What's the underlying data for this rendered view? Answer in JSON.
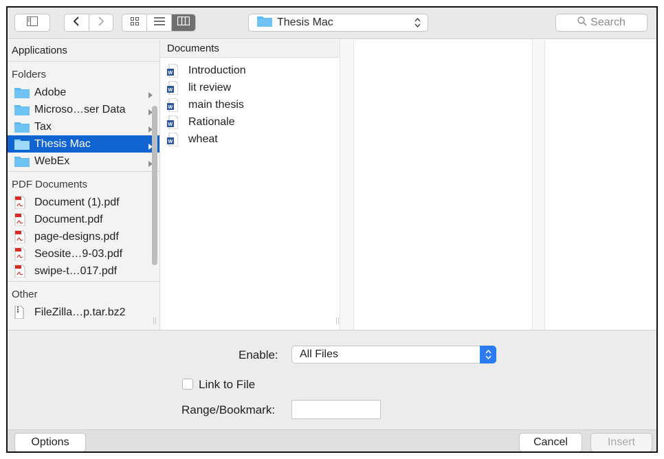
{
  "toolbar": {
    "location": "Thesis Mac",
    "search_placeholder": "Search"
  },
  "sidebar": {
    "header": "Applications",
    "sections": [
      {
        "title": "Folders",
        "items": [
          "Adobe",
          "Microso…ser Data",
          "Tax",
          "Thesis Mac",
          "WebEx"
        ],
        "selected": "Thesis Mac"
      },
      {
        "title": "PDF Documents",
        "items": [
          "Document (1).pdf",
          "Document.pdf",
          "page-designs.pdf",
          "Seosite…9-03.pdf",
          "swipe-t…017.pdf"
        ]
      },
      {
        "title": "Other",
        "items": [
          "FileZilla…p.tar.bz2"
        ]
      }
    ]
  },
  "column": {
    "header": "Documents",
    "files": [
      "Introduction",
      "lit review",
      "main thesis",
      "Rationale",
      "wheat"
    ]
  },
  "options": {
    "enable_label": "Enable:",
    "enable_value": "All Files",
    "link_label": "Link to File",
    "range_label": "Range/Bookmark:"
  },
  "buttons": {
    "options": "Options",
    "cancel": "Cancel",
    "insert": "Insert"
  },
  "colors": {
    "selection": "#0f64d2",
    "folder": "#5cb8f0",
    "word": "#2b579a",
    "pdf": "#d62b22"
  }
}
